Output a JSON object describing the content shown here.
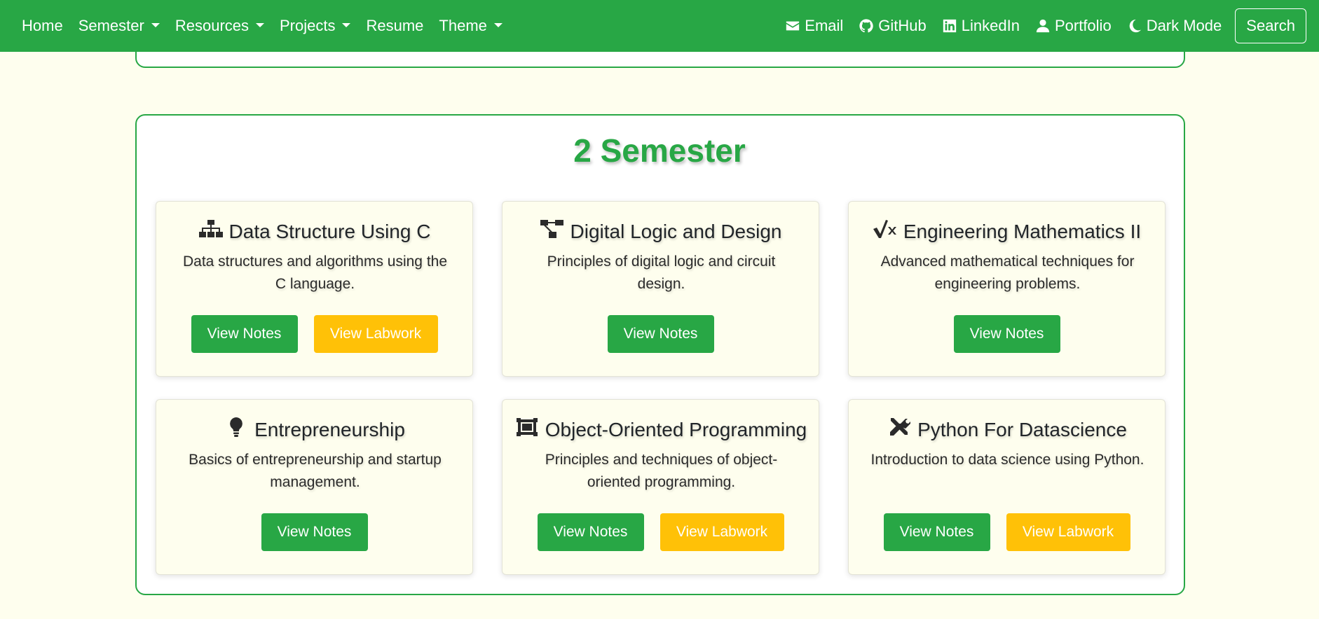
{
  "navbar": {
    "left": [
      {
        "label": "Home",
        "dropdown": false
      },
      {
        "label": "Semester",
        "dropdown": true
      },
      {
        "label": "Resources",
        "dropdown": true
      },
      {
        "label": "Projects",
        "dropdown": true
      },
      {
        "label": "Resume",
        "dropdown": false
      },
      {
        "label": "Theme",
        "dropdown": true
      }
    ],
    "right": [
      {
        "label": "Email",
        "icon": "envelope-icon"
      },
      {
        "label": "GitHub",
        "icon": "github-icon"
      },
      {
        "label": "LinkedIn",
        "icon": "linkedin-icon"
      },
      {
        "label": "Portfolio",
        "icon": "user-icon"
      },
      {
        "label": "Dark Mode",
        "icon": "moon-icon"
      }
    ],
    "search_label": "Search"
  },
  "section": {
    "title": "2 Semester",
    "cards": [
      {
        "title": "Data Structure Using C",
        "icon": "sitemap-icon",
        "desc": "Data structures and algorithms using the C language.",
        "buttons": [
          "View Notes",
          "View Labwork"
        ]
      },
      {
        "title": "Digital Logic and Design",
        "icon": "diagram-icon",
        "desc": "Principles of digital logic and circuit design.",
        "buttons": [
          "View Notes"
        ]
      },
      {
        "title": "Engineering Mathematics II",
        "icon": "square-root-icon",
        "desc": "Advanced mathematical techniques for engineering problems.",
        "buttons": [
          "View Notes"
        ]
      },
      {
        "title": "Entrepreneurship",
        "icon": "lightbulb-icon",
        "desc": "Basics of entrepreneurship and startup management.",
        "buttons": [
          "View Notes"
        ]
      },
      {
        "title": "Object-Oriented Programming",
        "icon": "object-group-icon",
        "desc": "Principles and techniques of object-oriented programming.",
        "buttons": [
          "View Notes",
          "View Labwork"
        ]
      },
      {
        "title": "Python For Datascience",
        "icon": "tools-icon",
        "desc": "Introduction to data science using Python.",
        "buttons": [
          "View Notes",
          "View Labwork"
        ]
      }
    ]
  },
  "colors": {
    "primary": "#28a745",
    "warning": "#ffc107",
    "background": "#fefeee"
  }
}
